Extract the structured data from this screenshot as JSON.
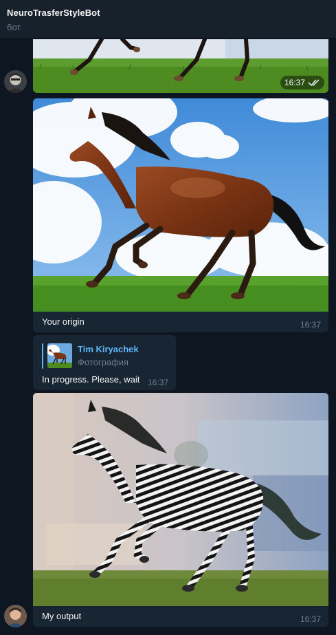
{
  "header": {
    "title": "NeuroTrasferStyleBot",
    "subtitle": "бот"
  },
  "messages": [
    {
      "type": "photo",
      "time": "16:37",
      "status": "read-double-check-icon"
    },
    {
      "type": "photo-caption",
      "caption": "Your origin",
      "time": "16:37"
    },
    {
      "type": "reply",
      "reply_name": "Tim Kiryachek",
      "reply_sub": "Фотография",
      "text": "In progress. Please, wait",
      "time": "16:37"
    },
    {
      "type": "photo-caption",
      "caption": "My output",
      "time": "16:37"
    }
  ],
  "colors": {
    "background": "#0e1621",
    "header": "#17212b",
    "bubble": "#182533",
    "accent": "#5eb5f7",
    "muted": "#6d7f8f"
  }
}
